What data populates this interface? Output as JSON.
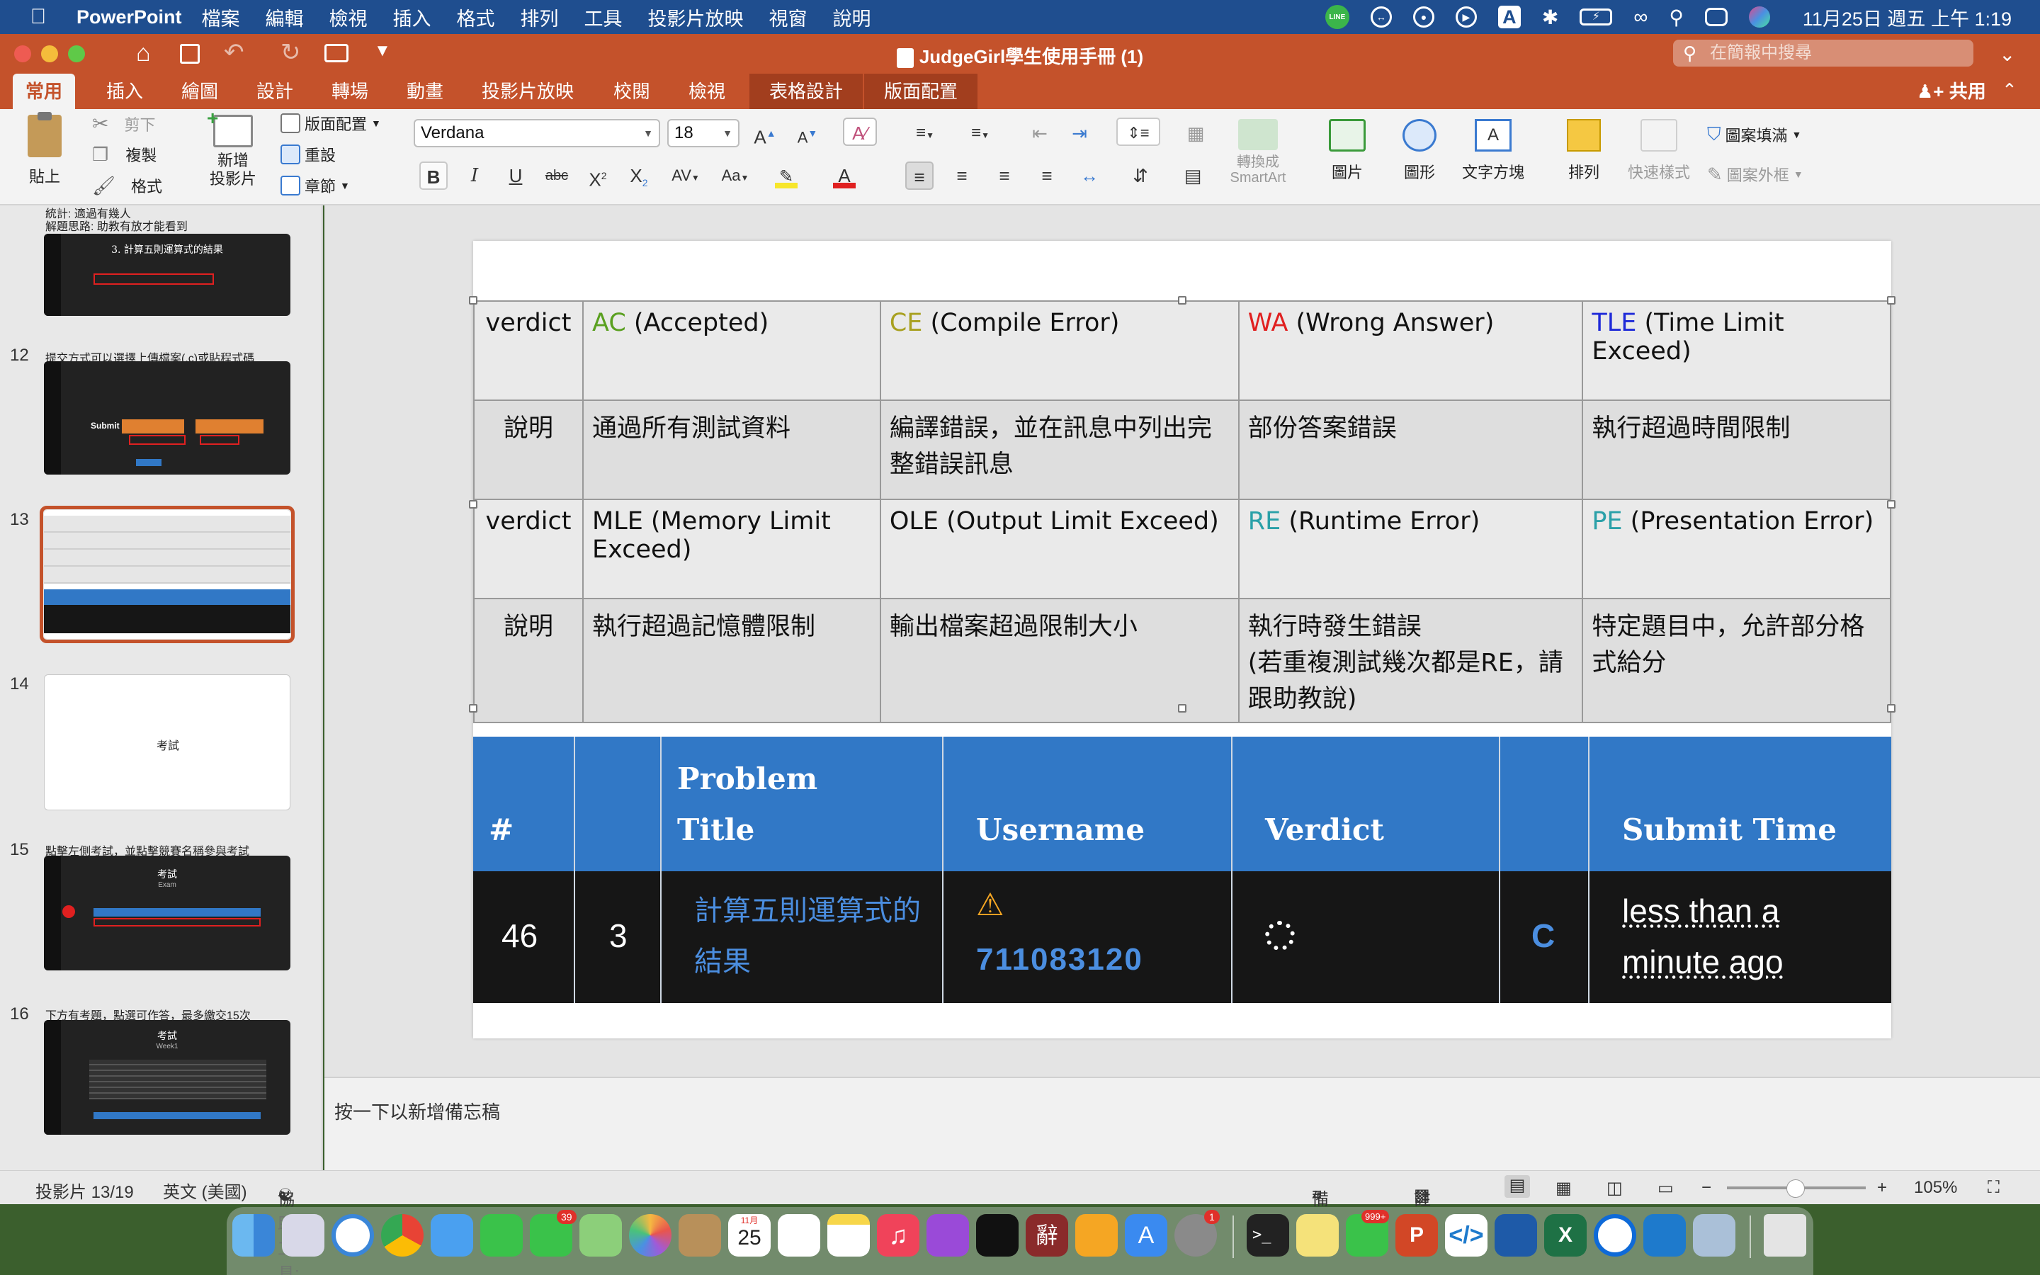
{
  "menubar": {
    "app_name": "PowerPoint",
    "items": [
      "檔案",
      "編輯",
      "檢視",
      "插入",
      "格式",
      "排列",
      "工具",
      "投影片放映",
      "視窗",
      "說明"
    ],
    "clock": "11月25日 週五 上午 1:19",
    "line_badge": "LINE"
  },
  "window": {
    "title": "JudgeGirl學生使用手冊 (1)",
    "search_placeholder": "在簡報中搜尋",
    "share_label": "共用"
  },
  "ribbon_tabs": [
    "常用",
    "插入",
    "繪圖",
    "設計",
    "轉場",
    "動畫",
    "投影片放映",
    "校閱",
    "檢視",
    "表格設計",
    "版面配置"
  ],
  "ribbon": {
    "paste": "貼上",
    "cut": "剪下",
    "copy": "複製",
    "format": "格式",
    "new_slide": "新增\n投影片",
    "layout": "版面配置",
    "reset": "重設",
    "section": "章節",
    "font_name": "Verdana",
    "font_size": "18",
    "convert_smartart": "轉換成\nSmartArt",
    "picture": "圖片",
    "shapes": "圖形",
    "textbox": "文字方塊",
    "arrange": "排列",
    "quick_styles": "快速樣式",
    "shape_fill": "圖案填滿",
    "shape_outline": "圖案外框"
  },
  "thumbnails": [
    {
      "num": "",
      "caption_lines": [
        "統計: 適過有幾人",
        "解題思路: 助教有放才能看到"
      ],
      "inner_title": "3. 計算五則運算式的結果"
    },
    {
      "num": "12",
      "caption": "提交方式可以選擇上傳檔案(.c)或貼程式碼",
      "inner_label": "Submit"
    },
    {
      "num": "13",
      "caption": "",
      "selected": true
    },
    {
      "num": "14",
      "caption": "",
      "center_text": "考試"
    },
    {
      "num": "15",
      "caption": "點擊左側考試，並點擊競賽名稱參與考試",
      "inner_title": "考試",
      "inner_sub": "Exam"
    },
    {
      "num": "16",
      "caption": "下方有考題，點選可作答，最多繳交15次",
      "inner_title": "考試",
      "inner_sub": "Week1"
    }
  ],
  "verdict_table": {
    "rows": [
      {
        "head": "verdict",
        "cells": [
          {
            "code": "AC",
            "code_color": "#5aa020",
            "text": " (Accepted)"
          },
          {
            "code": "CE",
            "code_color": "#a8a020",
            "text": " (Compile Error)"
          },
          {
            "code": "WA",
            "code_color": "#e02020",
            "text": " (Wrong Answer)"
          },
          {
            "code": "TLE",
            "code_color": "#1f2ad8",
            "text": " (Time Limit Exceed)"
          }
        ]
      },
      {
        "head": "說明",
        "cells": [
          {
            "code": "",
            "text": "通過所有測試資料"
          },
          {
            "code": "",
            "text": "編譯錯誤，並在訊息中列出完整錯誤訊息"
          },
          {
            "code": "",
            "text": "部份答案錯誤"
          },
          {
            "code": "",
            "text": "執行超過時間限制"
          }
        ]
      },
      {
        "head": "verdict",
        "cells": [
          {
            "code": "",
            "text": "MLE (Memory Limit Exceed)"
          },
          {
            "code": "",
            "text": "OLE (Output Limit Exceed)"
          },
          {
            "code": "RE",
            "code_color": "#2aa0a8",
            "text": " (Runtime Error)"
          },
          {
            "code": "PE",
            "code_color": "#2aa0a8",
            "text": " (Presentation Error)"
          }
        ]
      },
      {
        "head": "說明",
        "cells": [
          {
            "code": "",
            "text": "執行超過記憶體限制"
          },
          {
            "code": "",
            "text": "輸出檔案超過限制大小"
          },
          {
            "code": "",
            "text": "執行時發生錯誤\n(若重複測試幾次都是RE，請跟助教說)"
          },
          {
            "code": "",
            "text": "特定題目中，允許部分格式給分"
          }
        ]
      }
    ]
  },
  "submission_table": {
    "headers": [
      "#",
      "",
      "Problem\nTitle",
      "Username",
      "Verdict",
      "",
      "Submit Time"
    ],
    "row": {
      "id": "46",
      "num": "3",
      "title": "計算五則運算式的結果",
      "username": "711083120",
      "language": "C",
      "submit_time": "less than a minute ago"
    }
  },
  "notes_placeholder": "按一下以新增備忘稿",
  "statusbar": {
    "slide": "投影片 13/19",
    "language": "英文 (美國)",
    "accessibility": "協助工具: 調查",
    "notes": "備忘稿",
    "comments": "註解",
    "zoom": "105%"
  },
  "dock": {
    "calendar_month": "11月",
    "calendar_day": "25",
    "messages_badge": "39",
    "line_badge": "999+",
    "settings_badge": "1",
    "dict_char": "辭"
  },
  "colors": {
    "menubar": "#1f4e8f",
    "titlebar": "#c4522b",
    "table_header_blue": "#3178c6",
    "link_blue": "#4b8ee0"
  }
}
